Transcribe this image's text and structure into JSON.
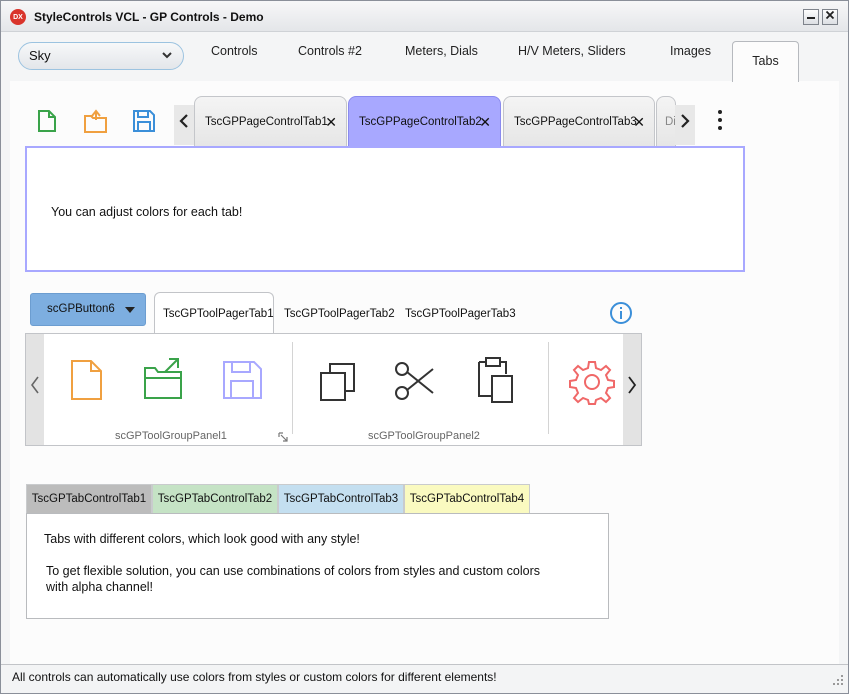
{
  "window": {
    "title": "StyleControls VCL - GP Controls - Demo",
    "app_icon_label": "DX"
  },
  "style_combo": {
    "value": "Sky"
  },
  "main_tabs": [
    {
      "label": "Controls"
    },
    {
      "label": "Controls #2"
    },
    {
      "label": "Meters, Dials"
    },
    {
      "label": "H/V Meters, Sliders"
    },
    {
      "label": "Images"
    },
    {
      "label": "Tabs",
      "active": true
    }
  ],
  "page_control": {
    "tabs": [
      {
        "label": "TscGPPageControlTab1"
      },
      {
        "label": "TscGPPageControlTab2",
        "active": true
      },
      {
        "label": "TscGPPageControlTab3"
      },
      {
        "label": "Di"
      }
    ],
    "text": "You can adjust colors for each tab!",
    "tab_active_color": "#a8a8ff"
  },
  "tool_pager": {
    "button": "scGPButton6",
    "tabs": [
      {
        "label": "TscGPToolPagerTab1",
        "active": true
      },
      {
        "label": "TscGPToolPagerTab2"
      },
      {
        "label": "TscGPToolPagerTab3"
      }
    ],
    "groups": [
      {
        "label": "scGPToolGroupPanel1"
      },
      {
        "label": "scGPToolGroupPanel2"
      }
    ],
    "button_color": "#7daee0"
  },
  "tab_control": {
    "tabs": [
      {
        "label": "TscGPTabControlTab1",
        "color": "#bcbcbc"
      },
      {
        "label": "TscGPTabControlTab2",
        "color": "#c5e3c5"
      },
      {
        "label": "TscGPTabControlTab3",
        "color": "#c4dff0"
      },
      {
        "label": "TscGPTabControlTab4",
        "color": "#fafac0"
      }
    ],
    "lines": [
      "Tabs with different colors, which look good with any style!",
      "To get flexible solution, you can use combinations of colors from styles and custom colors",
      "with alpha channel!"
    ]
  },
  "status": {
    "text": "All controls can automatically use colors from styles or custom colors for different elements!"
  }
}
